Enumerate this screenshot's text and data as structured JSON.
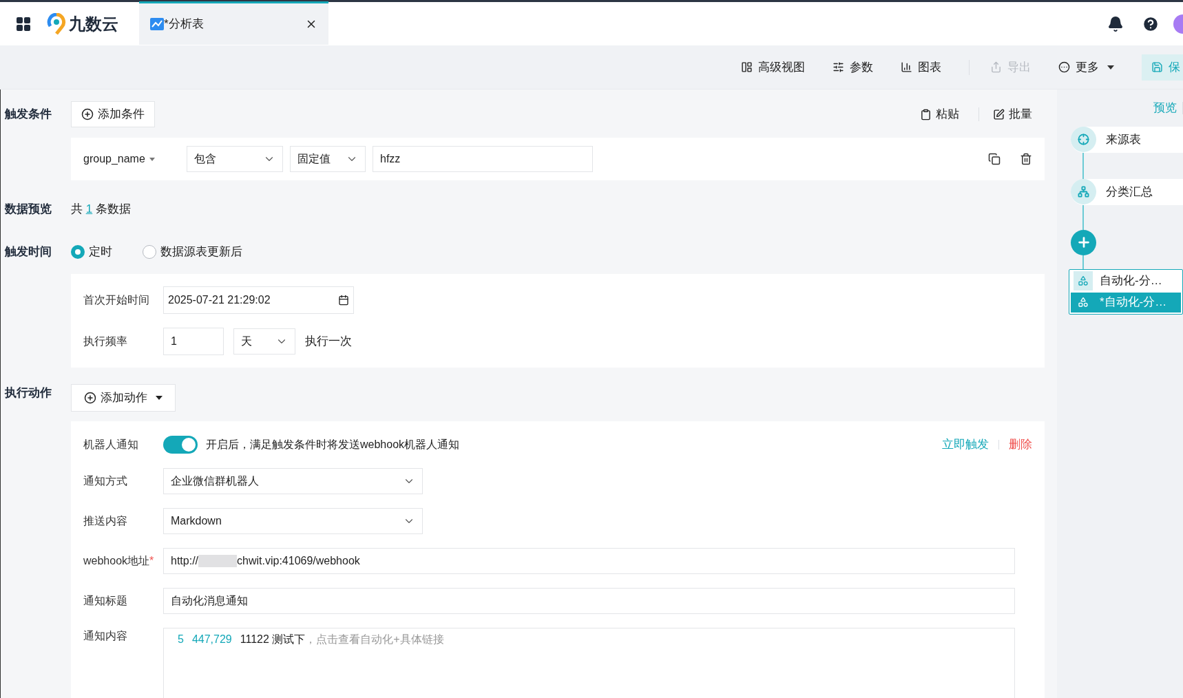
{
  "topbar": {
    "brand": "九数云",
    "tab": {
      "title": "*分析表"
    }
  },
  "toolbar": {
    "items": [
      {
        "label": "高级视图",
        "kind": "view",
        "disabled": false
      },
      {
        "label": "参数",
        "kind": "params",
        "disabled": false
      },
      {
        "label": "图表",
        "kind": "chart",
        "disabled": false
      },
      {
        "label": "导出",
        "kind": "export",
        "disabled": true
      },
      {
        "label": "更多",
        "kind": "more",
        "disabled": false
      }
    ],
    "save": "保"
  },
  "trigger": {
    "label": "触发条件",
    "add_button": "添加条件",
    "paste": "粘贴",
    "batch": "批量",
    "condition": {
      "field": "group_name",
      "operator": "包含",
      "value_type": "固定值",
      "value": "hfzz"
    }
  },
  "preview": {
    "label": "数据预览",
    "prefix": "共",
    "count": "1",
    "suffix": "条数据"
  },
  "time": {
    "label": "触发时间",
    "options": [
      {
        "label": "定时",
        "selected": true
      },
      {
        "label": "数据源表更新后",
        "selected": false
      }
    ],
    "start_label": "首次开始时间",
    "start_value": "2025-07-21 21:29:02",
    "freq_label": "执行频率",
    "freq_value": "1",
    "freq_unit": "天",
    "freq_suffix": "执行一次"
  },
  "action": {
    "label": "执行动作",
    "add_button": "添加动作",
    "robot": {
      "label": "机器人通知",
      "on": true,
      "description": "开启后，满足触发条件时将发送webhook机器人通知",
      "trigger_now": "立即触发",
      "delete": "删除"
    },
    "method": {
      "label": "通知方式",
      "value": "企业微信群机器人"
    },
    "content_type": {
      "label": "推送内容",
      "value": "Markdown"
    },
    "webhook": {
      "label": "webhook地址",
      "required_mark": "*",
      "value_start": "http://",
      "value_end": "chwit.vip:41069/webhook"
    },
    "title": {
      "label": "通知标题",
      "value": "自动化消息通知"
    },
    "body": {
      "label": "通知内容",
      "segments": [
        {
          "kind": "field",
          "text": "5"
        },
        {
          "kind": "field",
          "text": "447,729"
        },
        {
          "kind": "text",
          "text": "11122 测试下"
        },
        {
          "kind": "hint",
          "text": "，点击查看自动化+具体链接"
        }
      ]
    }
  },
  "flow": {
    "preview": "预览",
    "nodes": [
      {
        "label": "来源表",
        "kind": "source"
      },
      {
        "label": "分类汇总",
        "kind": "group"
      }
    ],
    "outputs": [
      {
        "label": "自动化-分…",
        "selected": false
      },
      {
        "label": "*自动化-分…",
        "selected": true
      }
    ]
  }
}
